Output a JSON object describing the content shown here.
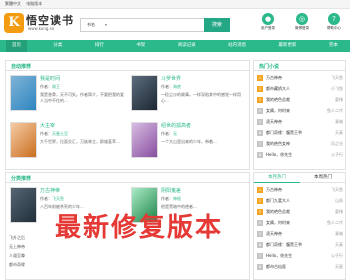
{
  "topbar": {
    "links": [
      "繁體中文",
      "电脑版本"
    ]
  },
  "header": {
    "logo_badge": "K",
    "logo_title": "悟空读书",
    "logo_url": "www.kong.so",
    "search": {
      "select": "书名",
      "placeholder": "",
      "button": "搜索"
    },
    "icons": [
      {
        "label": "用户登录",
        "color": "#2bb88b"
      },
      {
        "label": "微博登录",
        "color": "#2bb88b"
      },
      {
        "label": "帮助中心",
        "color": "#2bb88b"
      }
    ]
  },
  "nav": {
    "items": [
      "首页",
      "分类",
      "排行",
      "书架",
      "阅读记录",
      "站内消息",
      "最新更新",
      "完本"
    ]
  },
  "recommend": {
    "title": "自动推荐",
    "books": [
      {
        "name": "我是时间",
        "author": "周王",
        "desc": "我是香骨，天不可失。作者简介，不要把我的爱人当中不住的..."
      },
      {
        "name": "斗罗世界",
        "author": "海底",
        "desc": "一粒尘沙的故事。一样深陷其中的感觉一样用心..."
      },
      {
        "name": "大主宰",
        "author": "天蚕土豆",
        "desc": "大千世界，位面交汇，万族林立，群雄荟萃..."
      },
      {
        "name": "绍世的孤高者",
        "author": "无",
        "desc": "一个大山里出来的少年，带着..."
      }
    ]
  },
  "hot": {
    "title": "热门小说",
    "rows": [
      {
        "name": "万古神帝",
        "author": "飞天鱼"
      },
      {
        "name": "都市藏娇大人",
        "author": "小飞鱼"
      },
      {
        "name": "我的绝色总裁",
        "author": "夏栈"
      },
      {
        "name": "女婿，何时来",
        "author": "鱼人二代"
      },
      {
        "name": "凌天神帝",
        "author": "青城"
      },
      {
        "name": "都门奇缘：腹黑王爷",
        "author": "天真"
      },
      {
        "name": "我的绝色女神",
        "author": "风之谷"
      },
      {
        "name": "Hello，徐先生",
        "author": "公子行"
      }
    ]
  },
  "category": {
    "title": "分类推荐",
    "books": [
      {
        "name": "万古神帝",
        "author": "飞天鱼",
        "desc": "八百年前被杀死的少年..."
      },
      {
        "name": "阴阳鬼差",
        "author": "神秘",
        "desc": "他是黑暗中的使者..."
      }
    ],
    "lower": [
      "飞升之后",
      "无上神帝",
      "人道至尊",
      "都市奇缘"
    ]
  },
  "tabs": {
    "items": [
      "本月热门",
      "本周热门"
    ]
  },
  "hot2": {
    "rows": [
      {
        "name": "万古神帝",
        "author": "飞天鱼"
      },
      {
        "name": "都门九婴大人",
        "author": "山雨"
      },
      {
        "name": "我的绝色总裁",
        "author": "夏栈"
      },
      {
        "name": "女婿，何时来",
        "author": "鱼人二代"
      },
      {
        "name": "凌天神帝",
        "author": "青城"
      },
      {
        "name": "都门奇缘：腹黑王爷",
        "author": "天真"
      },
      {
        "name": "Hello，徐先生",
        "author": "公子行"
      },
      {
        "name": "都市古仙医",
        "author": "天星"
      }
    ]
  },
  "watermark": "最新修复版本",
  "colors": {
    "accent": "#2bb88b",
    "orange": "#f39c12",
    "red": "#e53935"
  }
}
